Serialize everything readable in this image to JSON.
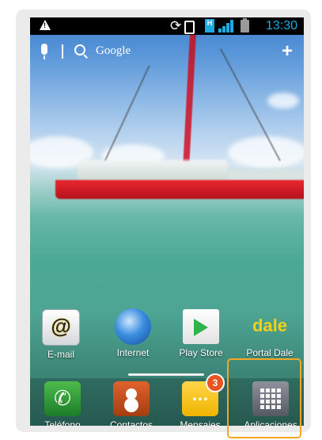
{
  "status_bar": {
    "time": "13:30",
    "icons": [
      "warning-icon",
      "sync-icon",
      "screen-rotate-icon",
      "data-h-icon",
      "signal-icon",
      "battery-icon"
    ],
    "data_type": "H"
  },
  "search_widget": {
    "label": "Google",
    "icons": [
      "microphone-icon",
      "search-icon",
      "add-icon"
    ]
  },
  "home_apps": [
    {
      "label": "E-mail",
      "icon": "email-icon"
    },
    {
      "label": "Internet",
      "icon": "globe-icon"
    },
    {
      "label": "Play Store",
      "icon": "play-store-icon"
    },
    {
      "label": "Portal Dale",
      "icon": "dale-icon",
      "icon_text": "dale"
    }
  ],
  "dock_apps": [
    {
      "label": "Teléfono",
      "icon": "phone-icon"
    },
    {
      "label": "Contactos",
      "icon": "contacts-icon"
    },
    {
      "label": "Mensajes",
      "icon": "messages-icon",
      "badge": "3"
    },
    {
      "label": "Aplicaciones",
      "icon": "apps-grid-icon"
    }
  ],
  "colors": {
    "status_bar_bg": "#000000",
    "clock_accent": "#1ea9e0",
    "highlight_border": "#f5a623",
    "badge": "#e8531f"
  }
}
